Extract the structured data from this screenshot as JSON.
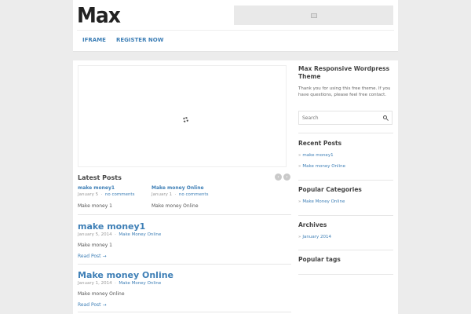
{
  "header": {
    "logo_text": "Max",
    "ad_icon": "image-placeholder-icon"
  },
  "nav": {
    "items": [
      "IFRAME",
      "REGISTER NOW"
    ]
  },
  "slider": {
    "loading_icon": "spinner-icon"
  },
  "latest_posts": {
    "title": "Latest Posts",
    "prev_icon": "‹",
    "next_icon": "›",
    "items": [
      {
        "title": "make money1",
        "date": "January 5",
        "comments": "no comments",
        "excerpt": "Make money 1"
      },
      {
        "title": "Make money Online",
        "date": "January 1",
        "comments": "no comments",
        "excerpt": "Make money Online"
      }
    ]
  },
  "posts": [
    {
      "title": "make money1",
      "date": "January 5, 2014",
      "category": "Make Money Online",
      "excerpt": "Make money 1",
      "read_more": "Read Post →"
    },
    {
      "title": "Make money Online",
      "date": "January 1, 2014",
      "category": "Make Money Online",
      "excerpt": "Make money Online",
      "read_more": "Read Post →"
    }
  ],
  "sidebar": {
    "theme_title": "Max Responsive Wordpress Theme",
    "theme_text": "Thank you for using this free theme. If you have questions, please feel free contact.",
    "search_placeholder": "Search",
    "recent_title": "Recent Posts",
    "recent_items": [
      "make money1",
      "Make money Online"
    ],
    "categories_title": "Popular Categories",
    "categories_items": [
      "Make Money Online"
    ],
    "archives_title": "Archives",
    "archives_items": [
      "January 2014"
    ],
    "tags_title": "Popular tags",
    "arrow": "»"
  },
  "colors": {
    "link": "#3e7fb6",
    "background": "#ececec"
  }
}
